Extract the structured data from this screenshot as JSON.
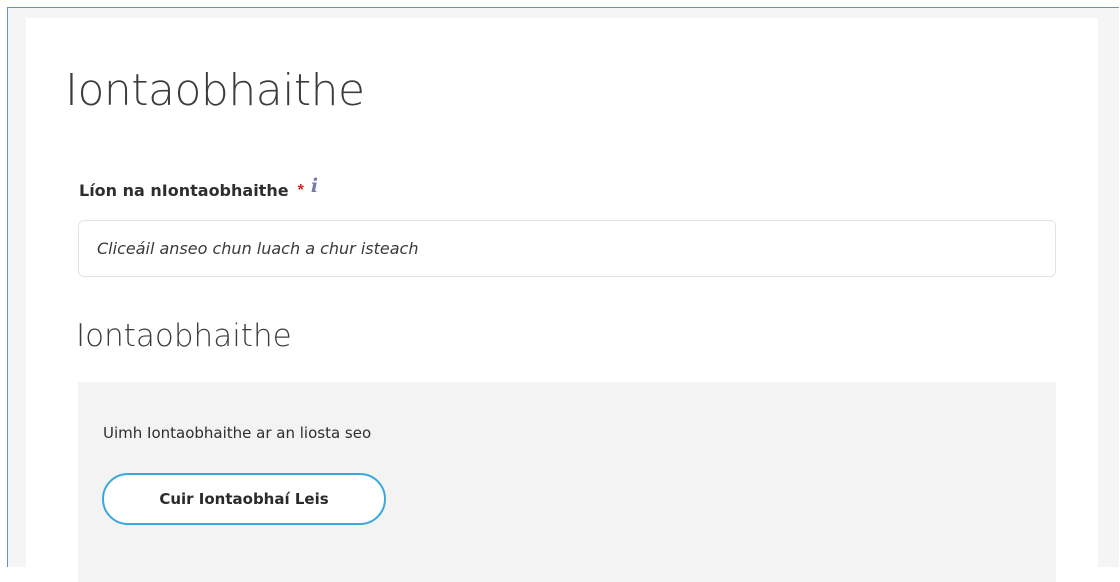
{
  "page": {
    "title": "Iontaobhaithe"
  },
  "field": {
    "label": "Líon na nIontaobhaithe",
    "required_mark": "*",
    "info_glyph": "i",
    "value": "",
    "placeholder": "Cliceáil anseo chun luach a chur isteach"
  },
  "section": {
    "heading": "Iontaobhaithe",
    "empty_message": "Uimh Iontaobhaithe ar an liosta seo",
    "add_button_label": "Cuir Iontaobhaí Leis"
  },
  "colors": {
    "required": "#e02020",
    "button_border": "#3aa8e0",
    "info_icon": "#7a7aa8",
    "list_background": "#f3f3f3"
  },
  "icons": {
    "info": "info-icon"
  }
}
